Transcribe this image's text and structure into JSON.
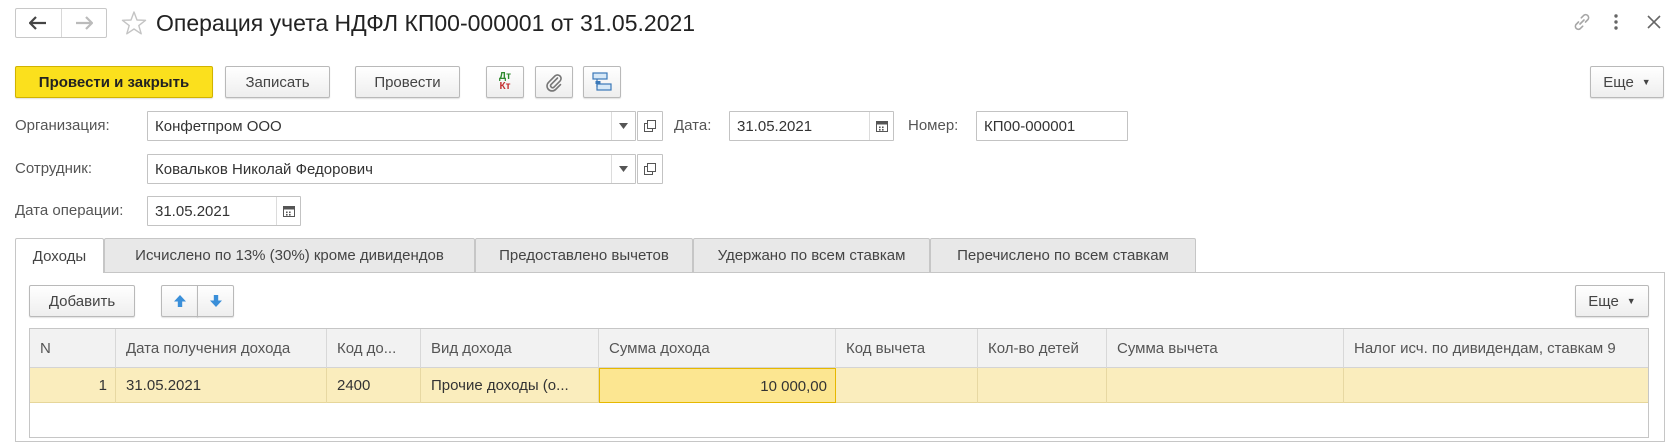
{
  "header": {
    "title": "Операция учета НДФЛ КП00-000001 от 31.05.2021"
  },
  "toolbar": {
    "post_close_label": "Провести и закрыть",
    "save_label": "Записать",
    "post_label": "Провести",
    "more_label": "Еще",
    "dt_kt_top": "Дт",
    "dt_kt_bottom": "Кт"
  },
  "form": {
    "organization_label": "Организация:",
    "organization_value": "Конфетпром ООО",
    "date_label": "Дата:",
    "date_value": "31.05.2021",
    "number_label": "Номер:",
    "number_value": "КП00-000001",
    "employee_label": "Сотрудник:",
    "employee_value": "Ковальков Николай Федорович",
    "operation_date_label": "Дата операции:",
    "operation_date_value": "31.05.2021"
  },
  "tabs": [
    {
      "label": "Доходы"
    },
    {
      "label": "Исчислено по 13% (30%) кроме дивидендов"
    },
    {
      "label": "Предоставлено вычетов"
    },
    {
      "label": "Удержано по всем ставкам"
    },
    {
      "label": "Перечислено по всем ставкам"
    }
  ],
  "table_toolbar": {
    "add_label": "Добавить",
    "more_label": "Еще"
  },
  "table": {
    "columns": [
      "N",
      "Дата получения дохода",
      "Код до...",
      "Вид дохода",
      "Сумма дохода",
      "Код вычета",
      "Кол-во детей",
      "Сумма вычета",
      "Налог исч. по дивидендам, ставкам 9"
    ],
    "rows": [
      {
        "n": "1",
        "date": "31.05.2021",
        "code": "2400",
        "kind": "Прочие доходы (о...",
        "amount": "10 000,00",
        "deduction_code": "",
        "children": "",
        "deduction_amount": "",
        "tax": ""
      }
    ]
  },
  "colors": {
    "primary_button": "#fbe01d",
    "selected_row": "#faedbd",
    "selected_cell_border": "#e6b800",
    "arrow_blue": "#3a8fd9"
  }
}
